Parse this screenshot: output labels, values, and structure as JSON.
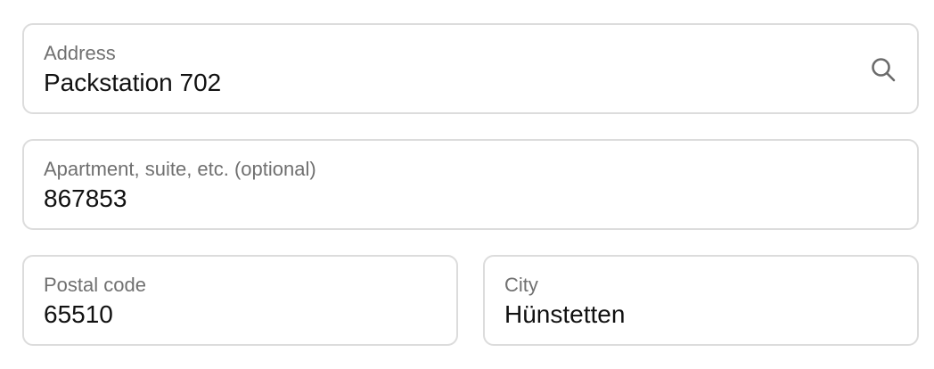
{
  "address": {
    "label": "Address",
    "value": "Packstation 702",
    "icon": "search-icon"
  },
  "apartment": {
    "label": "Apartment, suite, etc. (optional)",
    "value": "867853"
  },
  "postal_code": {
    "label": "Postal code",
    "value": "65510"
  },
  "city": {
    "label": "City",
    "value": "Hünstetten"
  },
  "colors": {
    "border": "#dcdcdc",
    "label": "#707070",
    "value": "#111111",
    "icon": "#6b6b6b"
  }
}
